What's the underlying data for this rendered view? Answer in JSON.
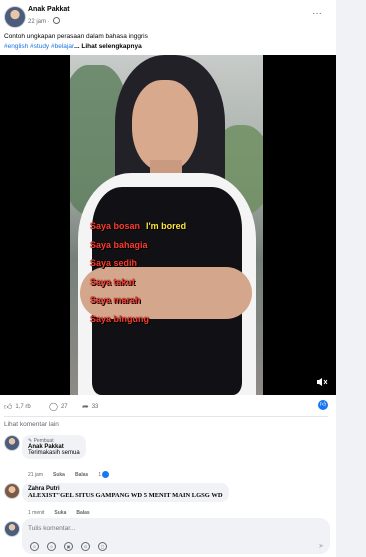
{
  "post": {
    "author": "Anak Pakkat",
    "time": "22 jam",
    "caption": "Contoh ungkapan perasaan dalam bahasa inggris",
    "tags": [
      "#english",
      "#study",
      "#belajar"
    ],
    "see_more": "... Lihat selengkapnya"
  },
  "video": {
    "lines": [
      {
        "id": "Saya bosan",
        "en": "I'm bored"
      },
      {
        "id": "Saya bahagia",
        "en": ""
      },
      {
        "id": "Saya sedih",
        "en": ""
      },
      {
        "id": "Saya takut",
        "en": ""
      },
      {
        "id": "Saya marah",
        "en": ""
      },
      {
        "id": "Saya bingung",
        "en": ""
      }
    ],
    "mute_icon": "speaker-muted-icon"
  },
  "reactions": {
    "likes": "1,7 rb",
    "comments": "27",
    "shares": "33"
  },
  "comments_section": {
    "more_comments_label": "Lihat komentar lain",
    "comments": [
      {
        "badge": "Pembuat",
        "author": "Anak Pakkat",
        "text": "Terimakasih semua",
        "time": "21 jam",
        "like_label": "Suka",
        "reply_label": "Balas",
        "reaction_count": "1"
      },
      {
        "badge": "",
        "author": "Zahra Putri",
        "text": "ALEXIST\"GEL SITUS GAMPANG WD 5 MENIT MAIN LGSG WD",
        "time": "1 menit",
        "like_label": "Suka",
        "reply_label": "Balas",
        "reaction_count": ""
      }
    ]
  },
  "composer": {
    "placeholder": "Tulis komentar..."
  }
}
